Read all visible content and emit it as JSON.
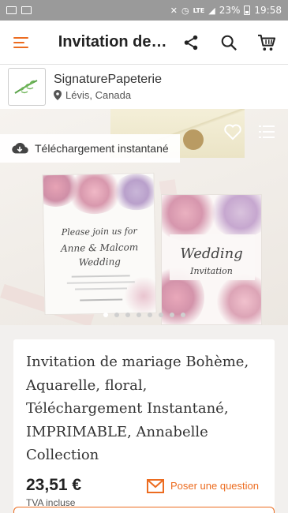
{
  "status_bar": {
    "signal_text": "LTE",
    "battery": "23%",
    "time": "19:58"
  },
  "app_bar": {
    "title": "Invitation de…",
    "icons": [
      "menu-icon",
      "share-icon",
      "search-icon",
      "cart-icon"
    ],
    "accent_color": "#ec6c20"
  },
  "store": {
    "name": "SignaturePapeterie",
    "location": "Lévis, Canada"
  },
  "hero": {
    "download_badge": "Téléchargement instantané",
    "card_left_lines": [
      "Please join us for",
      "Anne & Malcom",
      "Wedding"
    ],
    "card_right_lines": [
      "Wedding",
      "Invitation"
    ],
    "carousel_count": 8,
    "carousel_active": 0
  },
  "product": {
    "title": "Invitation de mariage Bohème, Aquarelle, floral, Téléchargement Instantané, IMPRIMABLE, Annabelle Collection",
    "price": "23,51 €",
    "vat": "TVA incluse",
    "ask_label": "Poser une question"
  }
}
